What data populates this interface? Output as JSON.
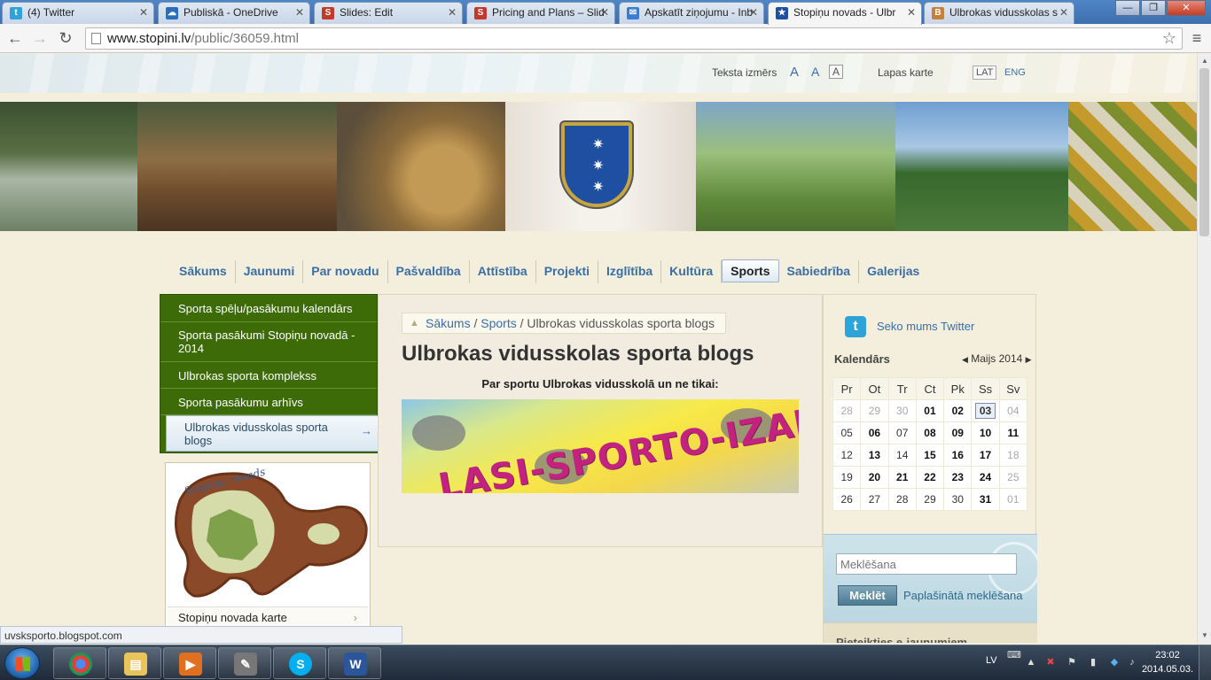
{
  "browser": {
    "tabs": [
      {
        "label": "(4) Twitter",
        "favicon": "twitter-icon",
        "color": "#2ea3d8"
      },
      {
        "label": "Publiskā - OneDrive",
        "favicon": "onedrive-icon",
        "color": "#2a6ebb"
      },
      {
        "label": "Slides: Edit",
        "favicon": "slides-icon",
        "color": "#c0392b"
      },
      {
        "label": "Pricing and Plans – Slid",
        "favicon": "slides-icon",
        "color": "#c0392b"
      },
      {
        "label": "Apskatīt ziņojumu - Inb",
        "favicon": "mail-icon",
        "color": "#3a7bd5"
      },
      {
        "label": "Stopiņu novads - Ulbr",
        "favicon": "crest-icon",
        "color": "#1f4fa0"
      },
      {
        "label": "Ulbrokas vidusskolas s",
        "favicon": "blogger-icon",
        "color": "#c4813a"
      }
    ],
    "url_host": "www.stopini.lv",
    "url_path": "/public/36059.html",
    "status_url": "uvsksporto.blogspot.com"
  },
  "header": {
    "text_size_label": "Teksta izmērs",
    "text_size_options": [
      "A",
      "A",
      "A"
    ],
    "sitemap": "Lapas karte",
    "lang_lat": "LAT",
    "lang_eng": "ENG"
  },
  "nav": {
    "items": [
      "Sākums",
      "Jaunumi",
      "Par novadu",
      "Pašvaldība",
      "Attīstība",
      "Projekti",
      "Izglītība",
      "Kultūra",
      "Sports",
      "Sabiedrība",
      "Galerijas"
    ],
    "active": "Sports"
  },
  "subnav": {
    "items": [
      "Sporta spēļu/pasākumu kalendārs",
      "Sporta pasākumi Stopiņu novadā - 2014",
      "Ulbrokas sporta komplekss",
      "Sporta pasākumu arhīvs",
      "Ulbrokas vidusskolas sporta blogs"
    ],
    "active_arrow": "→"
  },
  "map_box": {
    "map_title": "Stopiņu novads",
    "link_label": "Stopiņu novada karte"
  },
  "main": {
    "breadcrumb": {
      "home": "Sākums",
      "section": "Sports",
      "current": "Ulbrokas vidusskolas sporta blogs",
      "sep": "/"
    },
    "title": "Ulbrokas vidusskolas sporta blogs",
    "intro": "Par sportu Ulbrokas vidusskolā un ne tikai:",
    "banner_text": "LASI-SPORTO-IZAICINI!"
  },
  "sidebar": {
    "twitter_label": "Seko mums Twitter",
    "calendar": {
      "title": "Kalendārs",
      "month": "Maijs 2014",
      "weekdays": [
        "Pr",
        "Ot",
        "Tr",
        "Ct",
        "Pk",
        "Ss",
        "Sv"
      ],
      "weeks": [
        [
          "28",
          "29",
          "30",
          "01",
          "02",
          "03",
          "04"
        ],
        [
          "05",
          "06",
          "07",
          "08",
          "09",
          "10",
          "11"
        ],
        [
          "12",
          "13",
          "14",
          "15",
          "16",
          "17",
          "18"
        ],
        [
          "19",
          "20",
          "21",
          "22",
          "23",
          "24",
          "25"
        ],
        [
          "26",
          "27",
          "28",
          "29",
          "30",
          "31",
          "01"
        ]
      ],
      "today": "03"
    },
    "search_placeholder": "Meklēšana",
    "search_button": "Meklēt",
    "advanced_search": "Paplašinātā meklēšana",
    "newsletter": "Pieteikties e-jaunumiem"
  },
  "taskbar": {
    "language": "LV",
    "time": "23:02",
    "date": "2014.05.03."
  }
}
